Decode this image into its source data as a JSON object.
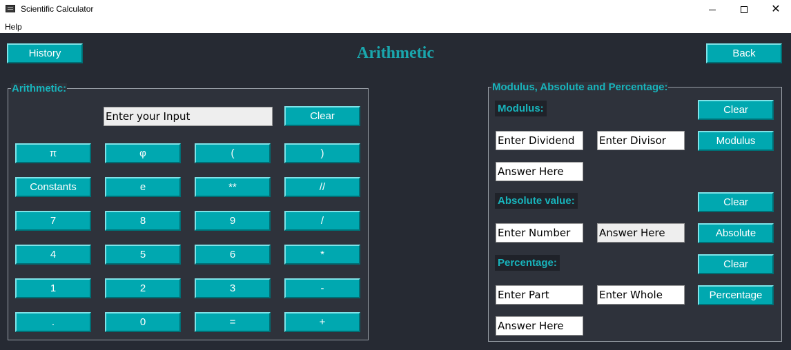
{
  "window": {
    "title": "Scientific Calculator",
    "menu_help": "Help"
  },
  "header": {
    "history_label": "History",
    "title": "Arithmetic",
    "back_label": "Back"
  },
  "arith": {
    "frame_title": "Arithmetic:",
    "input_placeholder": "Enter your Input",
    "clear_label": "Clear",
    "keys": [
      [
        "π",
        "φ",
        "(",
        ")"
      ],
      [
        "Constants",
        "e",
        "**",
        "//"
      ],
      [
        "7",
        "8",
        "9",
        "/"
      ],
      [
        "4",
        "5",
        "6",
        "*"
      ],
      [
        "1",
        "2",
        "3",
        "-"
      ],
      [
        ".",
        "0",
        "=",
        "+"
      ]
    ]
  },
  "mod": {
    "frame_title": "Modulus, Absolute and Percentage:",
    "modulus_label": "Modulus:",
    "modulus_clear": "Clear",
    "dividend_placeholder": "Enter Dividend",
    "divisor_placeholder": "Enter Divisor",
    "modulus_button": "Modulus",
    "modulus_answer": "Answer Here",
    "absolute_label": "Absolute value:",
    "absolute_clear": "Clear",
    "number_placeholder": "Enter Number",
    "absolute_answer": "Answer Here",
    "absolute_button": "Absolute",
    "percentage_label": "Percentage:",
    "percentage_clear": "Clear",
    "part_placeholder": "Enter Part",
    "whole_placeholder": "Enter Whole",
    "percentage_button": "Percentage",
    "percentage_answer": "Answer Here"
  },
  "colors": {
    "accent": "#00a8b0",
    "background": "#262a33",
    "frame": "#2e323b",
    "label_text": "#18b4bc"
  }
}
